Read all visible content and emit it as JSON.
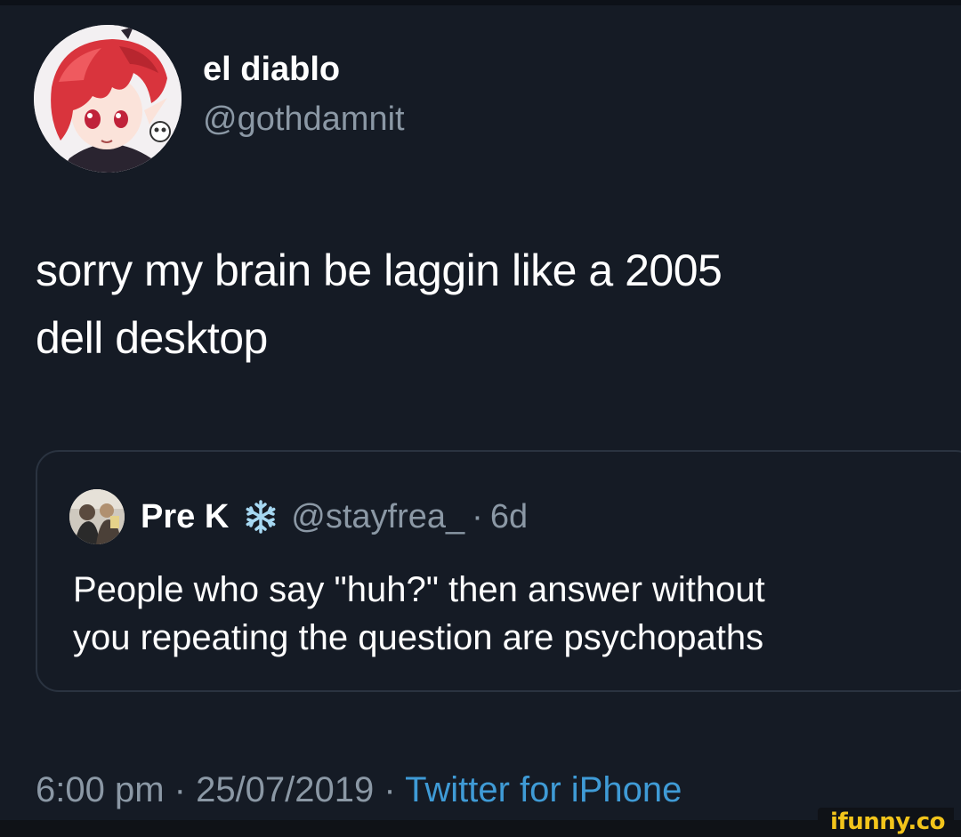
{
  "tweet": {
    "author": {
      "name": "el diablo",
      "handle": "@gothdamnit"
    },
    "text_line1": "sorry my brain be laggin like a 2005",
    "text_line2": "dell desktop",
    "quote": {
      "name": "Pre K",
      "handle": "@stayfrea_",
      "separator": "·",
      "age": "6d",
      "text_line1": "People who say \"huh?\" then answer without",
      "text_line2": "you repeating the question are psychopaths"
    },
    "meta": {
      "time": "6:00 pm",
      "separator1": " · ",
      "date": "25/07/2019",
      "separator2": " · ",
      "source": "Twitter for iPhone"
    }
  },
  "watermark": "ifunny.co",
  "icons": {
    "author_avatar": "anime-avatar-icon",
    "quote_avatar": "photo-avatar-icon",
    "name_emoji": "snowflake-icon"
  },
  "colors": {
    "background": "#151b25",
    "text_primary": "#ffffff",
    "text_secondary": "#8b98a5",
    "link": "#3f9bd6",
    "watermark": "#f2c41b"
  }
}
